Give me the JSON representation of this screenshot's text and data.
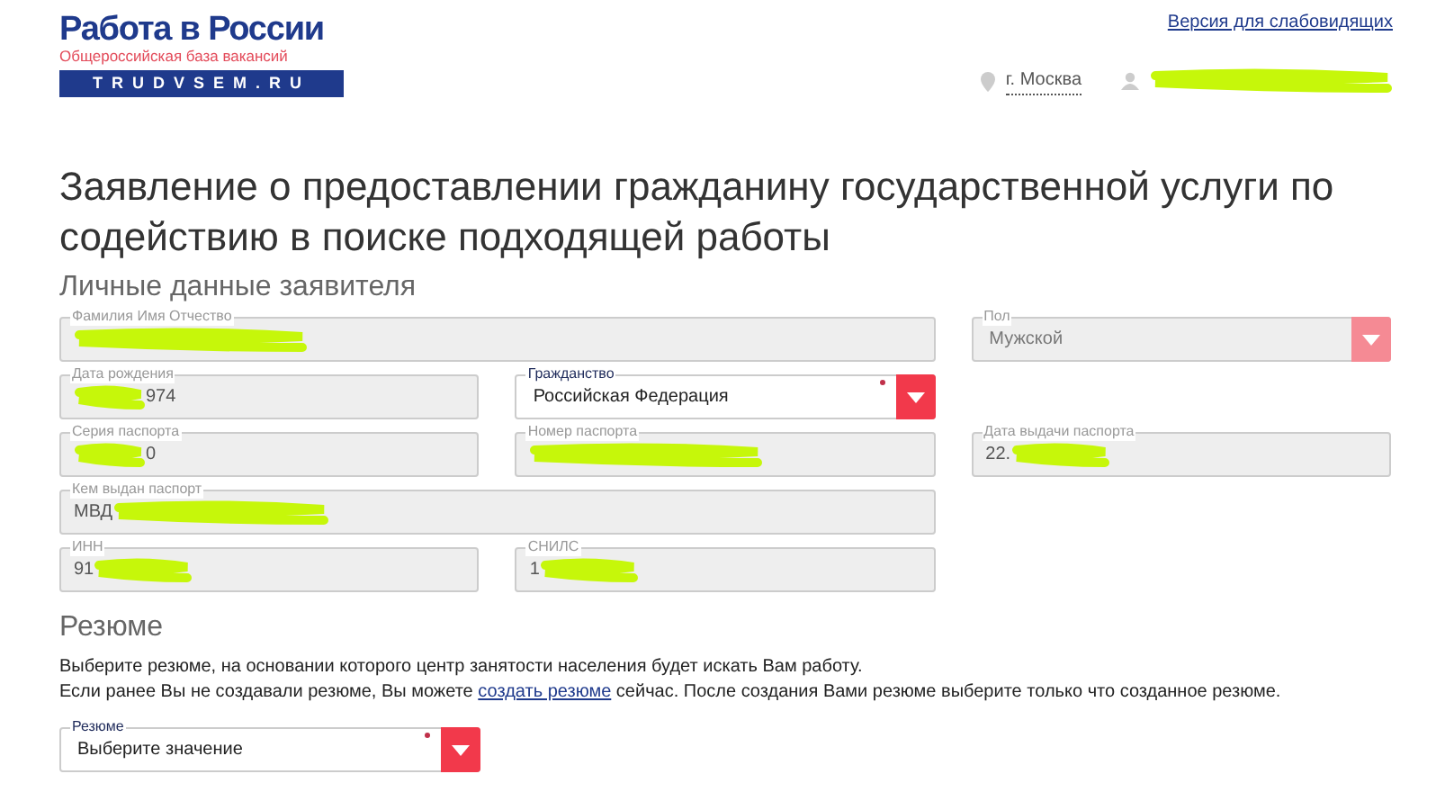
{
  "header": {
    "logo": {
      "title": "Работа в России",
      "subtitle": "Общероссийская база вакансий",
      "domain": "TRUDVSEM.RU"
    },
    "accessibility_link": "Версия для слабовидящих",
    "city": "г. Москва",
    "user": {
      "redacted": true
    }
  },
  "page_title": "Заявление о предоставлении гражданину государственной услуги по содействию в поиске подходящей работы",
  "personal": {
    "heading": "Личные данные заявителя",
    "fields": [
      {
        "kind": "text",
        "label": "Фамилия Имя Отчество",
        "redacted": true,
        "disabled": true
      },
      {
        "kind": "select",
        "label": "Пол",
        "value": "Мужской",
        "disabled": true,
        "required": false
      },
      {
        "kind": "text",
        "label": "Дата рождения",
        "redacted": true,
        "value_after": "974",
        "disabled": true
      },
      {
        "kind": "select",
        "label": "Гражданство",
        "value": "Российская Федерация",
        "disabled": false,
        "required": true
      },
      {
        "kind": "text",
        "label": "Серия паспорта",
        "redacted": true,
        "value_after": "0",
        "disabled": true
      },
      {
        "kind": "text",
        "label": "Номер паспорта",
        "redacted": true,
        "disabled": true
      },
      {
        "kind": "text",
        "label": "Дата выдачи паспорта",
        "value": "22.",
        "redacted": true,
        "disabled": true
      },
      {
        "kind": "text",
        "label": "Кем выдан паспорт",
        "value": "МВД",
        "redacted": true,
        "disabled": true
      },
      {
        "kind": "text",
        "label": "ИНН",
        "value": "91",
        "redacted": true,
        "disabled": true
      },
      {
        "kind": "text",
        "label": "СНИЛС",
        "value": "1",
        "redacted": true,
        "disabled": true
      }
    ]
  },
  "resume": {
    "heading": "Резюме",
    "line1": "Выберите резюме, на основании которого центр занятости населения будет искать Вам работу.",
    "line2_before": "Если ранее Вы не создавали резюме, Вы можете",
    "link": "создать резюме",
    "line2_after": "сейчас. После создания Вами резюме выберите только что созданное резюме.",
    "field": {
      "kind": "select",
      "label": "Резюме",
      "value": "Выберите значение",
      "disabled": false,
      "required": true
    }
  }
}
